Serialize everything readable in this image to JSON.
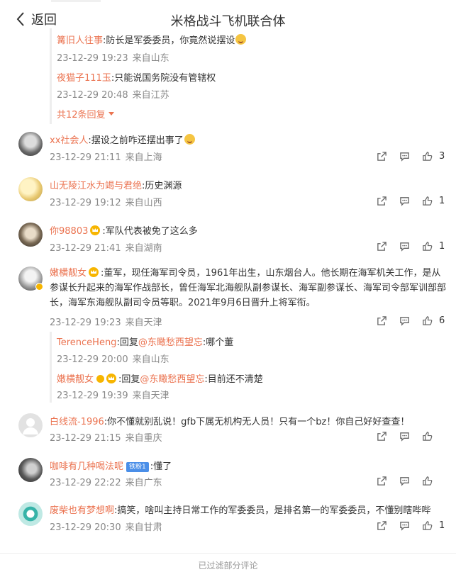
{
  "header": {
    "back_label": "返回",
    "title": "米格战斗飞机联合体"
  },
  "thread1": {
    "replies": [
      {
        "nick": "篝旧人往事",
        "text": ":防长是军委委员，你竟然说摆设",
        "date": "23-12-29 19:23",
        "loc": "来自山东"
      },
      {
        "nick": "夜猫子111玉",
        "text": ":只能说国务院没有管辖权",
        "date": "23-12-29 20:48",
        "loc": "来自江苏"
      }
    ],
    "more_label": "共12条回复"
  },
  "comments": [
    {
      "nick": "xx社会人",
      "text": ":摆设之前咋还摆出事了",
      "date": "23-12-29 21:11",
      "loc": "来自上海",
      "likes": "3"
    },
    {
      "nick": "山无陵江水为竭与君绝",
      "text": ":历史渊源",
      "date": "23-12-29 19:12",
      "loc": "来自山西",
      "likes": "1"
    },
    {
      "nick": "你98803",
      "text": ":军队代表被免了这么多",
      "date": "23-12-29 21:41",
      "loc": "来自湖南",
      "likes": "1"
    },
    {
      "nick": "嫩横靓女",
      "text": ":董军，现任海军司令员，1961年出生，山东烟台人。他长期在海军机关工作，是从参谋长升起来的海军作战部长，曾任海军北海舰队副参谋长、海军副参谋长、海军司令部军训部部长，海军东海舰队副司令员等职。2021年9月6日晋升上将军衔。",
      "date": "23-12-29 19:23",
      "loc": "来自天津",
      "likes": "6"
    },
    {
      "nick": "白线流-1996",
      "text": ":你不懂就别乱说！gfb下属无机构无人员！只有一个bz！你自己好好查查！",
      "date": "23-12-29 21:15",
      "loc": "来自重庆",
      "likes": ""
    },
    {
      "nick": "咖啡有几种喝法呢",
      "badge": "铁粉1",
      "text": ":懂了",
      "date": "23-12-29 22:22",
      "loc": "来自广东",
      "likes": ""
    },
    {
      "nick": "废柴也有梦想啊",
      "text": ":搞笑，啥叫主持日常工作的军委委员，是排名第一的军委委员，不懂别瞎哔哔",
      "date": "23-12-29 20:30",
      "loc": "来自甘肃",
      "likes": "1"
    }
  ],
  "thread4": {
    "replies": [
      {
        "nick": "TerenceHeng",
        "reply_prefix": ":回复",
        "mention": "@东瞰愁西望忘",
        "text": ":哪个董",
        "date": "23-12-29 20:00",
        "loc": "来自山东"
      },
      {
        "nick": "嫩横靓女",
        "reply_prefix": ":回复",
        "mention": "@东瞰愁西望忘",
        "text": ":目前还不清楚",
        "date": "23-12-29 19:39",
        "loc": "来自天津"
      }
    ]
  },
  "footer": {
    "text": "已过滤部分评论"
  },
  "colors": {
    "accent": "#eb7350",
    "meta": "#888888",
    "badge_blue": "#4b8fe8"
  }
}
